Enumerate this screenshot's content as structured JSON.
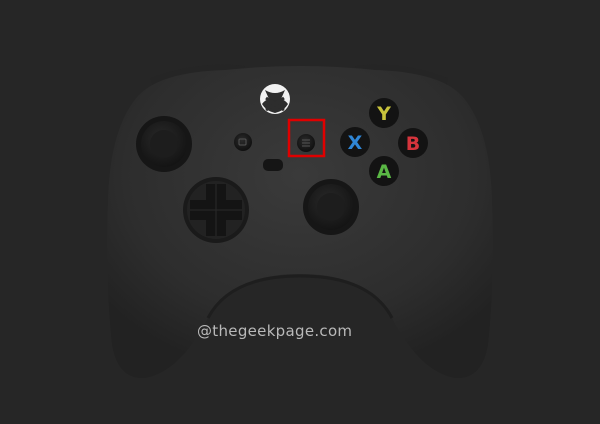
{
  "image": {
    "subject": "Xbox wireless controller, front view",
    "background_color": "#262626",
    "controller_color": "#2e2e2e",
    "highlight": {
      "target": "menu-button",
      "color": "#e00000"
    },
    "face_buttons": [
      {
        "letter": "Y",
        "color": "#c9c43c"
      },
      {
        "letter": "X",
        "color": "#2f86d6"
      },
      {
        "letter": "B",
        "color": "#d6343c"
      },
      {
        "letter": "A",
        "color": "#5ab845"
      }
    ],
    "icons": [
      "xbox-logo-icon",
      "view-button",
      "menu-button",
      "share-button",
      "d-pad",
      "left-thumbstick",
      "right-thumbstick"
    ]
  },
  "watermark": "@thegeekpage.com"
}
